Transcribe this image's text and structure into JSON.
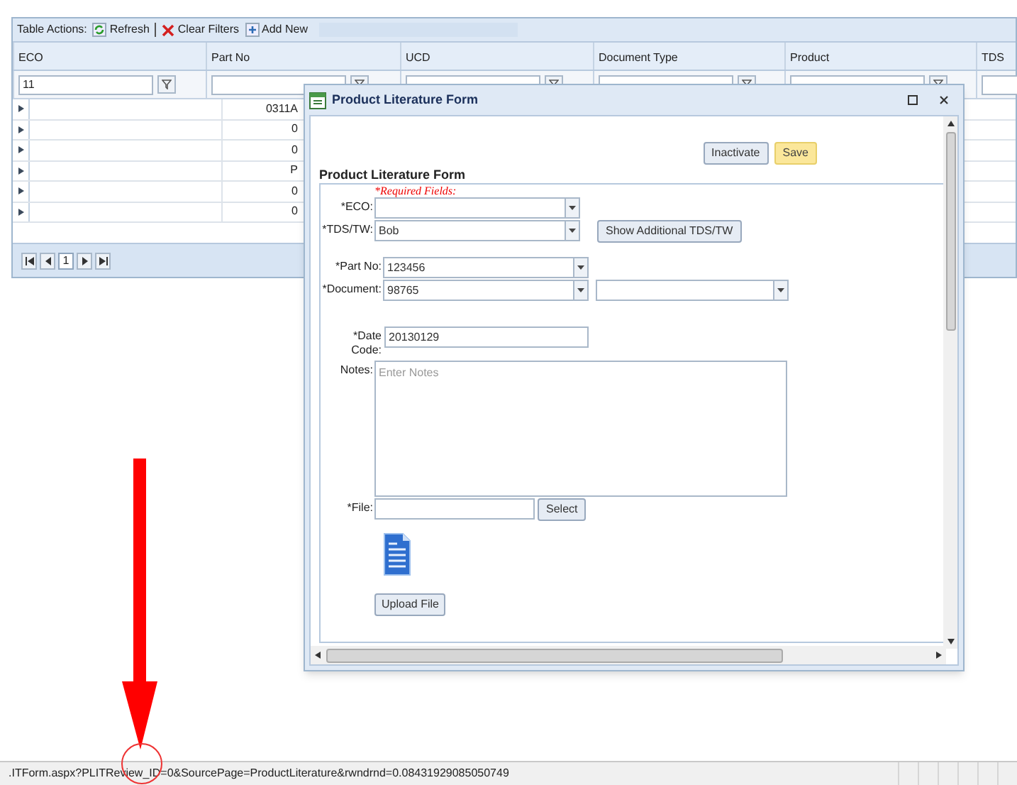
{
  "toolbar": {
    "label": "Table Actions:",
    "actions": [
      {
        "label": "Refresh",
        "kind": "refresh"
      },
      {
        "label": "Clear Filters",
        "kind": "clear"
      },
      {
        "label": "Add New",
        "kind": "add"
      }
    ]
  },
  "grid": {
    "columns": [
      "ECO",
      "Part No",
      "UCD",
      "Document Type",
      "Product",
      "TDS"
    ],
    "eco_filter": "11",
    "rows": [
      {
        "part_no": "0311A"
      },
      {
        "part_no": "0"
      },
      {
        "part_no": "0"
      },
      {
        "part_no": "P"
      },
      {
        "part_no": "0"
      },
      {
        "part_no": "0"
      }
    ],
    "pager": {
      "page": "1"
    }
  },
  "dialog": {
    "title": "Product Literature Form",
    "buttons": [
      {
        "label": "Inactivate",
        "kind": "default"
      },
      {
        "label": "Save",
        "kind": "primary"
      }
    ],
    "heading": "Product Literature Form",
    "required_note": "*Required Fields:",
    "fields": [
      {
        "label": "*ECO:",
        "kind": "combo"
      },
      {
        "label": "*TDS/TW:",
        "kind": "combo",
        "value": "Bob",
        "button": "Show Additional TDS/TW"
      },
      {
        "label": "*Part No:",
        "kind": "combo",
        "value": "123456"
      },
      {
        "label": "*Document:",
        "kind": "combo_pair",
        "value": "98765"
      },
      {
        "label": "*Date Code:",
        "kind": "text",
        "value": "20130129"
      },
      {
        "label": "Notes:",
        "kind": "textarea",
        "placeholder": "Enter Notes"
      },
      {
        "label": "*File:",
        "kind": "file",
        "button": "Select"
      }
    ],
    "upload_button": "Upload File"
  },
  "status_bar": {
    "url": ".ITForm.aspx?PLITReview_ID=0&SourcePage=ProductLiterature&rwndrnd=0.08431929085050749"
  }
}
